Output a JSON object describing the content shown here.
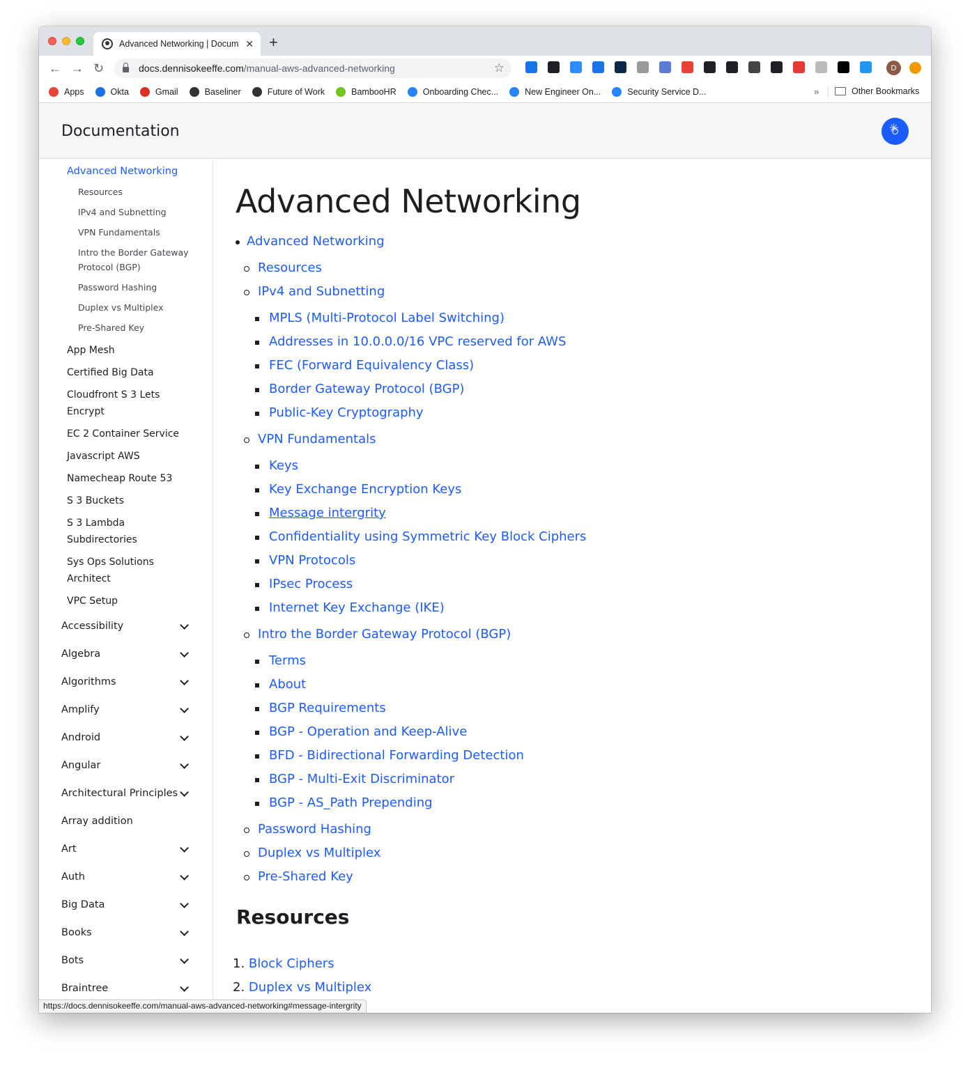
{
  "browser": {
    "tab_title": "Advanced Networking | Docum",
    "tab_close": "✕",
    "new_tab": "+",
    "url_host": "docs.dennisokeeffe.com",
    "url_path": "/manual-aws-advanced-networking",
    "avatar_letter": "D",
    "status_url": "https://docs.dennisokeeffe.com/manual-aws-advanced-networking#message-intergrity",
    "extension_icons": [
      "#1a73e8",
      "#202124",
      "#2d8cff",
      "#1a73e8",
      "#0b2a4a",
      "#999999",
      "#5b7bd5",
      "#e94235",
      "#202124",
      "#202124",
      "#444444",
      "#202124",
      "#e53935",
      "#bbbbbb",
      "#000000",
      "#2196f3"
    ]
  },
  "bookmarks": {
    "items": [
      {
        "label": "Apps",
        "color": "#ea4335"
      },
      {
        "label": "Okta",
        "color": "#1a73e8"
      },
      {
        "label": "Gmail",
        "color": "#d93025"
      },
      {
        "label": "Baseliner",
        "color": "#333333"
      },
      {
        "label": "Future of Work",
        "color": "#333333"
      },
      {
        "label": "BambooHR",
        "color": "#73c41d"
      },
      {
        "label": "Onboarding Chec...",
        "color": "#2684ff"
      },
      {
        "label": "New Engineer On...",
        "color": "#2684ff"
      },
      {
        "label": "Security Service D...",
        "color": "#2684ff"
      }
    ],
    "overflow": "»",
    "other": "Other Bookmarks"
  },
  "site": {
    "title": "Documentation",
    "accent": "#1a5cff"
  },
  "sidebar": {
    "active": "Advanced Networking",
    "sub_items": [
      "Resources",
      "IPv4 and Subnetting",
      "VPN Fundamentals",
      "Intro the Border Gateway Protocol (BGP)",
      "Password Hashing",
      "Duplex vs Multiplex",
      "Pre-Shared Key"
    ],
    "siblings": [
      "App Mesh",
      "Certified Big Data",
      "Cloudfront S 3 Lets Encrypt",
      "EC 2 Container Service",
      "Javascript AWS",
      "Namecheap Route 53",
      "S 3 Buckets",
      "S 3 Lambda Subdirectories",
      "Sys Ops Solutions Architect",
      "VPC Setup"
    ],
    "categories": [
      {
        "label": "Accessibility",
        "expandable": true
      },
      {
        "label": "Algebra",
        "expandable": true
      },
      {
        "label": "Algorithms",
        "expandable": true
      },
      {
        "label": "Amplify",
        "expandable": true
      },
      {
        "label": "Android",
        "expandable": true
      },
      {
        "label": "Angular",
        "expandable": true
      },
      {
        "label": "Architectural Principles",
        "expandable": true
      },
      {
        "label": "Array addition",
        "expandable": false
      },
      {
        "label": "Art",
        "expandable": true
      },
      {
        "label": "Auth",
        "expandable": true
      },
      {
        "label": "Big Data",
        "expandable": true
      },
      {
        "label": "Books",
        "expandable": true
      },
      {
        "label": "Bots",
        "expandable": true
      },
      {
        "label": "Braintree",
        "expandable": true
      }
    ]
  },
  "main": {
    "heading": "Advanced Networking",
    "toc": {
      "root": "Advanced Networking",
      "resources": "Resources",
      "ipv4": {
        "label": "IPv4 and Subnetting",
        "children": [
          "MPLS (Multi-Protocol Label Switching)",
          "Addresses in 10.0.0.0/16 VPC reserved for AWS",
          "FEC (Forward Equivalency Class)",
          "Border Gateway Protocol (BGP)",
          "Public-Key Cryptography"
        ]
      },
      "vpn": {
        "label": "VPN Fundamentals",
        "children": [
          "Keys",
          "Key Exchange Encryption Keys",
          "Message intergrity",
          "Confidentiality using Symmetric Key Block Ciphers",
          "VPN Protocols",
          "IPsec Process",
          "Internet Key Exchange (IKE)"
        ]
      },
      "bgp": {
        "label": "Intro the Border Gateway Protocol (BGP)",
        "children": [
          "Terms",
          "About",
          "BGP Requirements",
          "BGP - Operation and Keep-Alive",
          "BFD - Bidirectional Forwarding Detection",
          "BGP - Multi-Exit Discriminator",
          "BGP - AS_Path Prepending"
        ]
      },
      "tail": [
        "Password Hashing",
        "Duplex vs Multiplex",
        "Pre-Shared Key"
      ]
    },
    "resources_heading": "Resources",
    "resources_list": [
      {
        "num": "1.",
        "label": "Block Ciphers"
      },
      {
        "num": "2.",
        "label": "Duplex vs Multiplex"
      }
    ]
  }
}
